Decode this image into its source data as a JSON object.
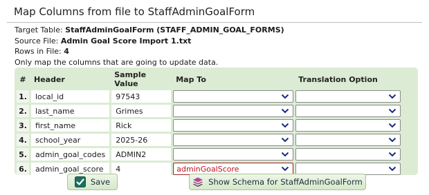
{
  "window": {
    "title": "Map Columns from file to StaffAdminGoalForm"
  },
  "info": {
    "target_label": "Target Table: ",
    "target_value": "StaffAdminGoalForm (STAFF_ADMIN_GOAL_FORMS)",
    "source_label": "Source File: ",
    "source_value": "Admin Goal Score Import 1.txt",
    "rows_label": "Rows in File: ",
    "rows_value": "4",
    "note": "Only map the columns that are going to update data."
  },
  "table": {
    "headers": [
      "#",
      "Header",
      "Sample Value",
      "Map To",
      "Translation Option"
    ],
    "rows": [
      {
        "num": "1.",
        "header": "local_id",
        "sample": "97543",
        "map_to": "",
        "translation": ""
      },
      {
        "num": "2.",
        "header": "last_name",
        "sample": "Grimes",
        "map_to": "",
        "translation": ""
      },
      {
        "num": "3.",
        "header": "first_name",
        "sample": "Rick",
        "map_to": "",
        "translation": ""
      },
      {
        "num": "4.",
        "header": "school_year",
        "sample": "2025-26",
        "map_to": "",
        "translation": ""
      },
      {
        "num": "5.",
        "header": "admin_goal_codes",
        "sample": "ADMIN2",
        "map_to": "",
        "translation": ""
      },
      {
        "num": "6.",
        "header": "admin_goal_score",
        "sample": "4",
        "map_to": "adminGoalScore",
        "translation": ""
      }
    ]
  },
  "buttons": {
    "save": "Save",
    "schema": "Show Schema for StaffAdminGoalForm"
  },
  "icons": {
    "save": "checkbox-check-icon",
    "schema": "stack-layers-icon",
    "select": "chevron-down-icon"
  },
  "colors": {
    "accent_green": "#dcebd3",
    "active_select": "#c2121b"
  }
}
